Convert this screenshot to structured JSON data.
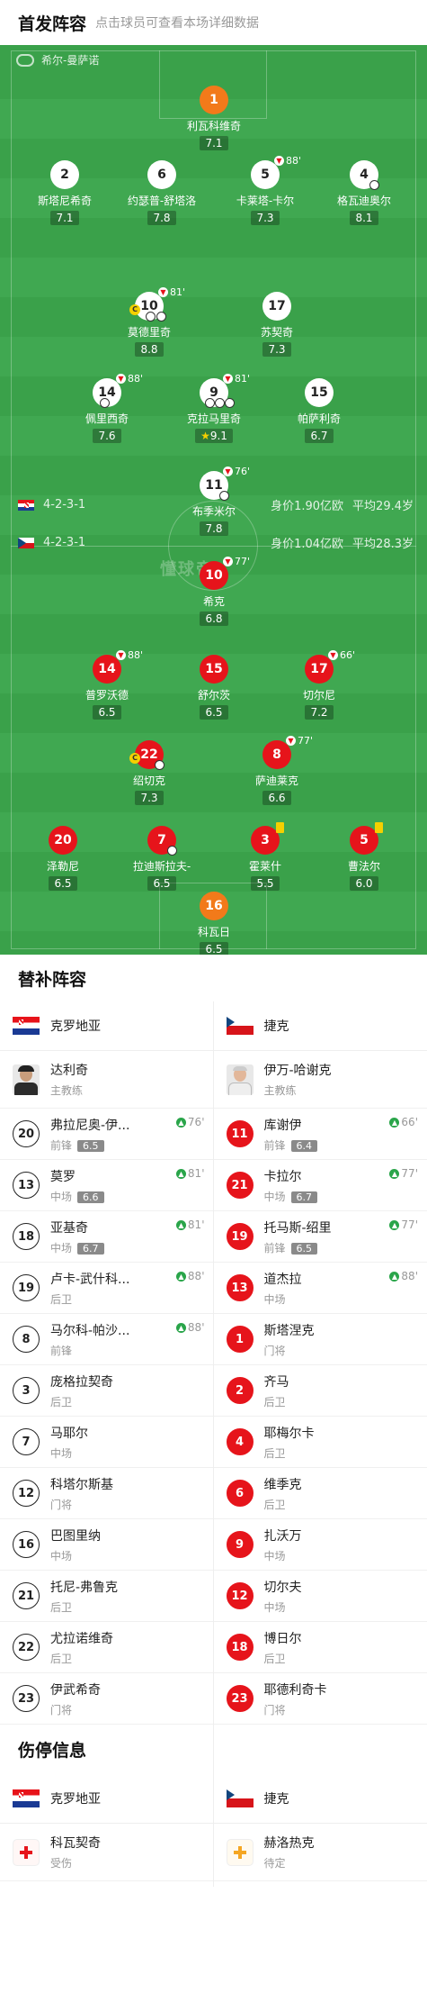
{
  "header": {
    "title": "首发阵容",
    "subtitle": "点击球员可查看本场详细数据"
  },
  "pitch": {
    "stadium": "希尔-曼萨诺",
    "watermark": "懂球帝",
    "home_line": {
      "formation": "4-2-3-1",
      "value": "身价1.90亿欧",
      "age": "平均29.4岁"
    },
    "away_line": {
      "formation": "4-2-3-1",
      "value": "身价1.04亿欧",
      "age": "平均28.3岁"
    }
  },
  "home_players": [
    {
      "num": "1",
      "name": "利瓦科维奇",
      "rating": "7.1"
    },
    {
      "num": "2",
      "name": "斯塔尼希奇",
      "rating": "7.1"
    },
    {
      "num": "6",
      "name": "约瑟普-舒塔洛",
      "rating": "7.8"
    },
    {
      "num": "5",
      "name": "卡莱塔-卡尔",
      "rating": "7.3",
      "sub": "88'"
    },
    {
      "num": "4",
      "name": "格瓦迪奥尔",
      "rating": "8.1"
    },
    {
      "num": "10",
      "name": "莫德里奇",
      "rating": "8.8",
      "sub": "81'"
    },
    {
      "num": "17",
      "name": "苏契奇",
      "rating": "7.3"
    },
    {
      "num": "14",
      "name": "佩里西奇",
      "rating": "7.6",
      "sub": "88'"
    },
    {
      "num": "9",
      "name": "克拉马里奇",
      "rating": "9.1",
      "sub": "81'"
    },
    {
      "num": "15",
      "name": "帕萨利奇",
      "rating": "6.7"
    },
    {
      "num": "11",
      "name": "布季米尔",
      "rating": "7.8",
      "sub": "76'"
    }
  ],
  "away_players": [
    {
      "num": "10",
      "name": "希克",
      "rating": "6.8",
      "sub": "77'"
    },
    {
      "num": "14",
      "name": "普罗沃德",
      "rating": "6.5",
      "sub": "88'"
    },
    {
      "num": "15",
      "name": "舒尔茨",
      "rating": "6.5"
    },
    {
      "num": "17",
      "name": "切尔尼",
      "rating": "7.2",
      "sub": "66'"
    },
    {
      "num": "22",
      "name": "绍切克",
      "rating": "7.3"
    },
    {
      "num": "8",
      "name": "萨迪莱克",
      "rating": "6.6",
      "sub": "77'"
    },
    {
      "num": "20",
      "name": "泽勒尼",
      "rating": "6.5"
    },
    {
      "num": "7",
      "name": "拉迪斯拉夫-",
      "rating": "6.5"
    },
    {
      "num": "3",
      "name": "霍莱什",
      "rating": "5.5"
    },
    {
      "num": "5",
      "name": "曹法尔",
      "rating": "6.0"
    },
    {
      "num": "16",
      "name": "科瓦日",
      "rating": "6.5"
    }
  ],
  "bench": {
    "title": "替补阵容",
    "home_team": "克罗地亚",
    "away_team": "捷克",
    "home_coach": {
      "name": "达利奇",
      "role": "主教练"
    },
    "away_coach": {
      "name": "伊万-哈谢克",
      "role": "主教练"
    },
    "rows": [
      [
        {
          "num": "20",
          "name": "弗拉尼奥-伊...",
          "pos": "前锋",
          "rating": "6.5",
          "min": "76'"
        },
        {
          "num": "11",
          "name": "库谢伊",
          "pos": "前锋",
          "rating": "6.4",
          "min": "66'"
        }
      ],
      [
        {
          "num": "13",
          "name": "莫罗",
          "pos": "中场",
          "rating": "6.6",
          "min": "81'"
        },
        {
          "num": "21",
          "name": "卡拉尔",
          "pos": "中场",
          "rating": "6.7",
          "min": "77'"
        }
      ],
      [
        {
          "num": "18",
          "name": "亚基奇",
          "pos": "中场",
          "rating": "6.7",
          "min": "81'"
        },
        {
          "num": "19",
          "name": "托马斯-绍里",
          "pos": "前锋",
          "rating": "6.5",
          "min": "77'"
        }
      ],
      [
        {
          "num": "19",
          "name": "卢卡-武什科...",
          "pos": "后卫",
          "rating": "",
          "min": "88'"
        },
        {
          "num": "13",
          "name": "道杰拉",
          "pos": "中场",
          "rating": "",
          "min": "88'"
        }
      ],
      [
        {
          "num": "8",
          "name": "马尔科-帕沙...",
          "pos": "前锋",
          "rating": "",
          "min": "88'"
        },
        {
          "num": "1",
          "name": "斯塔涅克",
          "pos": "门将",
          "rating": "",
          "min": ""
        }
      ],
      [
        {
          "num": "3",
          "name": "庞格拉契奇",
          "pos": "后卫",
          "rating": "",
          "min": ""
        },
        {
          "num": "2",
          "name": "齐马",
          "pos": "后卫",
          "rating": "",
          "min": ""
        }
      ],
      [
        {
          "num": "7",
          "name": "马耶尔",
          "pos": "中场",
          "rating": "",
          "min": ""
        },
        {
          "num": "4",
          "name": "耶梅尔卡",
          "pos": "后卫",
          "rating": "",
          "min": ""
        }
      ],
      [
        {
          "num": "12",
          "name": "科塔尔斯基",
          "pos": "门将",
          "rating": "",
          "min": ""
        },
        {
          "num": "6",
          "name": "维季克",
          "pos": "后卫",
          "rating": "",
          "min": ""
        }
      ],
      [
        {
          "num": "16",
          "name": "巴图里纳",
          "pos": "中场",
          "rating": "",
          "min": ""
        },
        {
          "num": "9",
          "name": "扎沃万",
          "pos": "中场",
          "rating": "",
          "min": ""
        }
      ],
      [
        {
          "num": "21",
          "name": "托尼-弗鲁克",
          "pos": "后卫",
          "rating": "",
          "min": ""
        },
        {
          "num": "12",
          "name": "切尔夫",
          "pos": "中场",
          "rating": "",
          "min": ""
        }
      ],
      [
        {
          "num": "22",
          "name": "尤拉诺维奇",
          "pos": "后卫",
          "rating": "",
          "min": ""
        },
        {
          "num": "18",
          "name": "博日尔",
          "pos": "后卫",
          "rating": "",
          "min": ""
        }
      ],
      [
        {
          "num": "23",
          "name": "伊武希奇",
          "pos": "门将",
          "rating": "",
          "min": ""
        },
        {
          "num": "23",
          "name": "耶德利奇卡",
          "pos": "门将",
          "rating": "",
          "min": ""
        }
      ]
    ]
  },
  "injury": {
    "title": "伤停信息",
    "home_team": "克罗地亚",
    "away_team": "捷克",
    "home": {
      "name": "科瓦契奇",
      "status": "受伤"
    },
    "away": {
      "name": "赫洛热克",
      "status": "待定"
    }
  },
  "colors": {
    "pitch": "#3aa14a",
    "home_kit": "#ffffff",
    "away_kit": "#e6141b",
    "gk_kit": "#f27a1a"
  }
}
